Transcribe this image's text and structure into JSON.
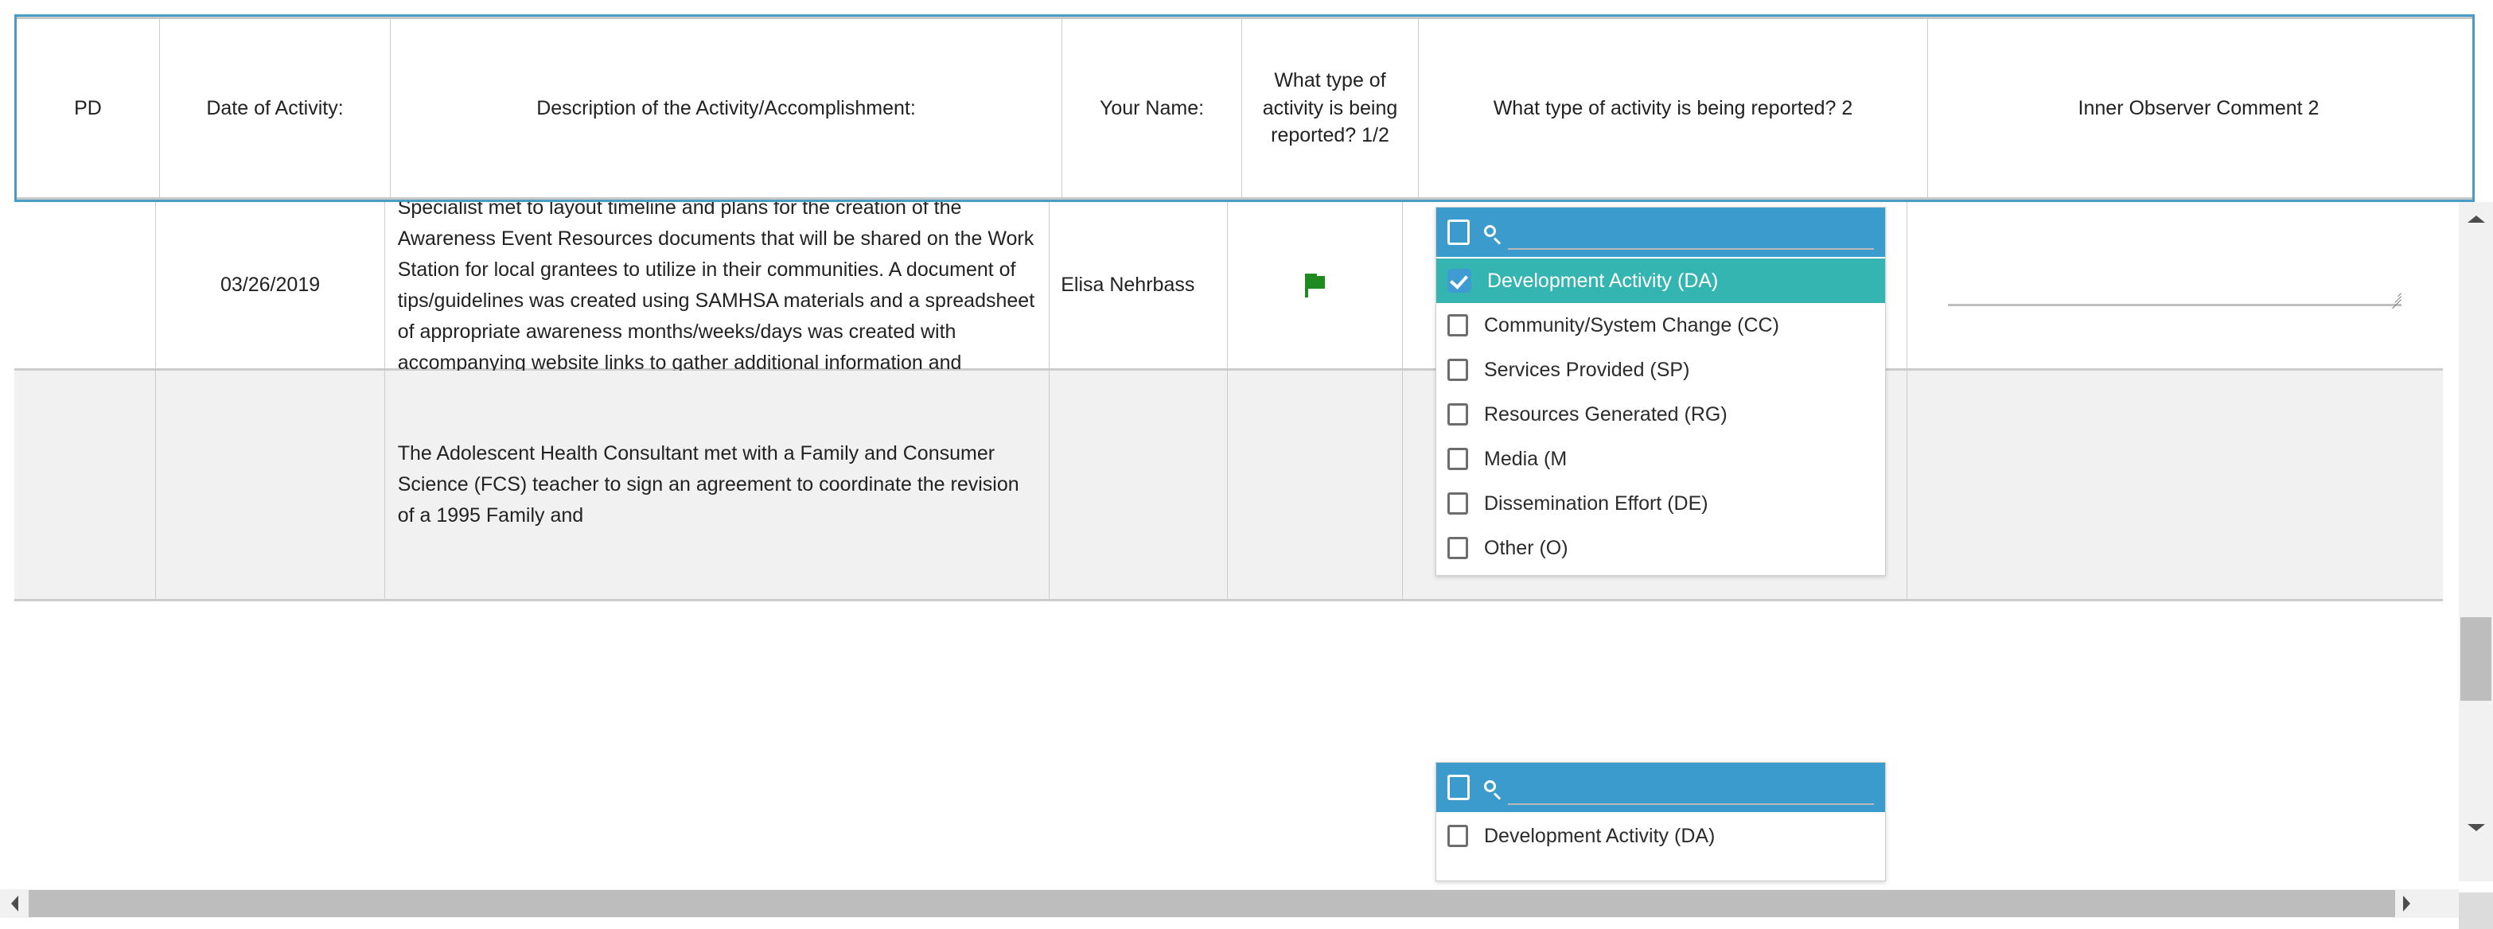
{
  "table": {
    "columns": [
      {
        "key": "pd",
        "label": "PD"
      },
      {
        "key": "date",
        "label": "Date of Activity:"
      },
      {
        "key": "desc",
        "label": "Description of the Activity/Accomplishment:"
      },
      {
        "key": "name",
        "label": "Your Name:"
      },
      {
        "key": "type1",
        "label": "What type of activity is being reported? 1/2"
      },
      {
        "key": "type2",
        "label": "What type of activity is being reported? 2"
      },
      {
        "key": "comment2",
        "label": "Inner Observer Comment 2"
      }
    ],
    "rows": [
      {
        "pd": "",
        "date": "03/26/2019",
        "desc": "The Child and Adolescent Health Consultant and the Behavioral Specialist met to layout timeline and plans for the creation of the Awareness Event Resources documents that will be shared on the Work Station for local grantees to utilize in their communities. A document of tips/guidelines was created using SAMHSA materials and a spreadsheet of appropriate awareness months/weeks/days was created with accompanying website links to gather additional information and resources for the community awareness event initiatives.",
        "name": "Elisa Nehrbass",
        "flag_icon": "flag-icon",
        "comment2": ""
      },
      {
        "pd": "",
        "date": "",
        "desc": "The Adolescent Health Consultant met with a Family and Consumer Science (FCS) teacher to sign an agreement to coordinate the revision of a 1995 Family and",
        "name": "",
        "flag_icon": "",
        "comment2": ""
      }
    ]
  },
  "dropdown_1": {
    "search_placeholder": "",
    "search_value": "",
    "search_icon": "search-icon",
    "select_all_checked": false,
    "options": [
      {
        "label": "Development Activity (DA)",
        "checked": true
      },
      {
        "label": "Community/System Change (CC)",
        "checked": false
      },
      {
        "label": "Services Provided (SP)",
        "checked": false
      },
      {
        "label": "Resources Generated (RG)",
        "checked": false
      },
      {
        "label": "Media (M",
        "checked": false
      },
      {
        "label": "Dissemination Effort (DE)",
        "checked": false
      },
      {
        "label": "Other (O)",
        "checked": false
      }
    ]
  },
  "dropdown_2": {
    "search_placeholder": "",
    "search_value": "",
    "search_icon": "search-icon",
    "select_all_checked": false,
    "options": [
      {
        "label": "Development Activity (DA)",
        "checked": false
      }
    ]
  },
  "colors": {
    "header_border": "#4a9cc7",
    "search_bar": "#3b9bcd",
    "selected_option": "#35b5b2",
    "checked_box": "#3f9cd2",
    "grid_line": "#cccccc",
    "alt_row": "#f1f1f1",
    "flag_green": "#1f8a1f",
    "scrollbar_thumb": "#bdbdbd"
  },
  "scrollbars": {
    "vertical": {
      "up_icon": "triangle-up-icon",
      "down_icon": "triangle-down-icon"
    },
    "horizontal": {
      "left_icon": "triangle-left-icon",
      "right_icon": "triangle-right-icon"
    }
  }
}
